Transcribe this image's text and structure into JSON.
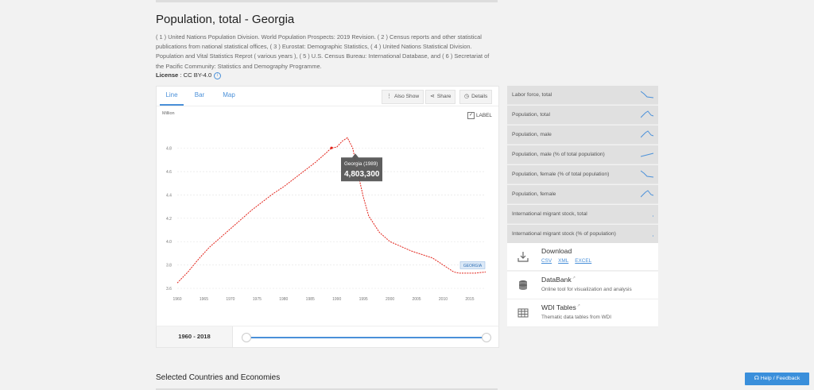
{
  "header": {
    "title": "Population, total - Georgia",
    "sources": "( 1 ) United Nations Population Division. World Population Prospects: 2019 Revision. ( 2 ) Census reports and other statistical publications from national statistical offices, ( 3 ) Eurostat: Demographic Statistics, ( 4 ) United Nations Statistical Division. Population and Vital Statistics Reprot ( various years ), ( 5 ) U.S. Census Bureau: International Database, and ( 6 ) Secretariat of the Pacific Community: Statistics and Demography Programme.",
    "license_label": "License",
    "license_value": " : CC BY-4.0"
  },
  "tabs": [
    {
      "label": "Line",
      "active": true
    },
    {
      "label": "Bar",
      "active": false
    },
    {
      "label": "Map",
      "active": false
    }
  ],
  "toolbar": {
    "also_show": "Also Show",
    "share": "Share",
    "details": "Details"
  },
  "label_toggle": "LABEL",
  "tooltip": {
    "title": "Georgia (1989)",
    "value": "4,803,300"
  },
  "range": {
    "label": "1960 - 2018"
  },
  "sidebar": {
    "items": [
      {
        "label": "Labor force, total",
        "spark": "down"
      },
      {
        "label": "Population, total",
        "spark": "hump"
      },
      {
        "label": "Population, male",
        "spark": "hump"
      },
      {
        "label": "Population, male (% of total population)",
        "spark": "up"
      },
      {
        "label": "Population, female (% of total population)",
        "spark": "down"
      },
      {
        "label": "Population, female",
        "spark": "hump"
      },
      {
        "label": "International migrant stock, total",
        "spark": "dot"
      },
      {
        "label": "International migrant stock (% of population)",
        "spark": "dot"
      }
    ]
  },
  "cards": {
    "download": {
      "title": "Download",
      "links": [
        "CSV",
        "XML",
        "EXCEL"
      ]
    },
    "databank": {
      "title": "DataBank",
      "sub": "Online tool for visualization and analysis"
    },
    "wdi": {
      "title": "WDI Tables",
      "sub": "Thematic data tables from WDI"
    }
  },
  "footer": {
    "selected": "Selected Countries and Economies",
    "help": "Help / Feedback"
  },
  "colors": {
    "accent": "#4a90d9",
    "series": "#e2231a",
    "sidebar_bg": "#e0e0e0"
  },
  "chart_data": {
    "type": "line",
    "ylabel": "Million",
    "ylim": [
      3.6,
      4.92
    ],
    "yticks": [
      3.6,
      3.8,
      4.0,
      4.2,
      4.4,
      4.6,
      4.8
    ],
    "ytick_labels": [
      "3.6",
      "3.8",
      "4.0",
      "4.2",
      "4.4",
      "4.6",
      "4.8"
    ],
    "xlim": [
      1960,
      2018
    ],
    "xticks": [
      1960,
      1965,
      1970,
      1975,
      1980,
      1985,
      1990,
      1995,
      2000,
      2005,
      2010,
      2015
    ],
    "grid": true,
    "series": [
      {
        "name": "GEORGIA",
        "x": [
          1960,
          1962,
          1964,
          1966,
          1968,
          1970,
          1972,
          1974,
          1976,
          1978,
          1980,
          1982,
          1984,
          1986,
          1988,
          1989,
          1990,
          1991,
          1992,
          1993,
          1994,
          1995,
          1996,
          1998,
          2000,
          2002,
          2004,
          2006,
          2008,
          2010,
          2012,
          2013,
          2014,
          2016,
          2018
        ],
        "values": [
          3.646,
          3.74,
          3.85,
          3.95,
          4.03,
          4.11,
          4.19,
          4.27,
          4.34,
          4.41,
          4.47,
          4.54,
          4.61,
          4.68,
          4.76,
          4.803,
          4.81,
          4.86,
          4.89,
          4.8,
          4.58,
          4.38,
          4.22,
          4.08,
          4.0,
          3.96,
          3.92,
          3.89,
          3.86,
          3.8,
          3.74,
          3.73,
          3.73,
          3.73,
          3.74
        ]
      }
    ]
  }
}
